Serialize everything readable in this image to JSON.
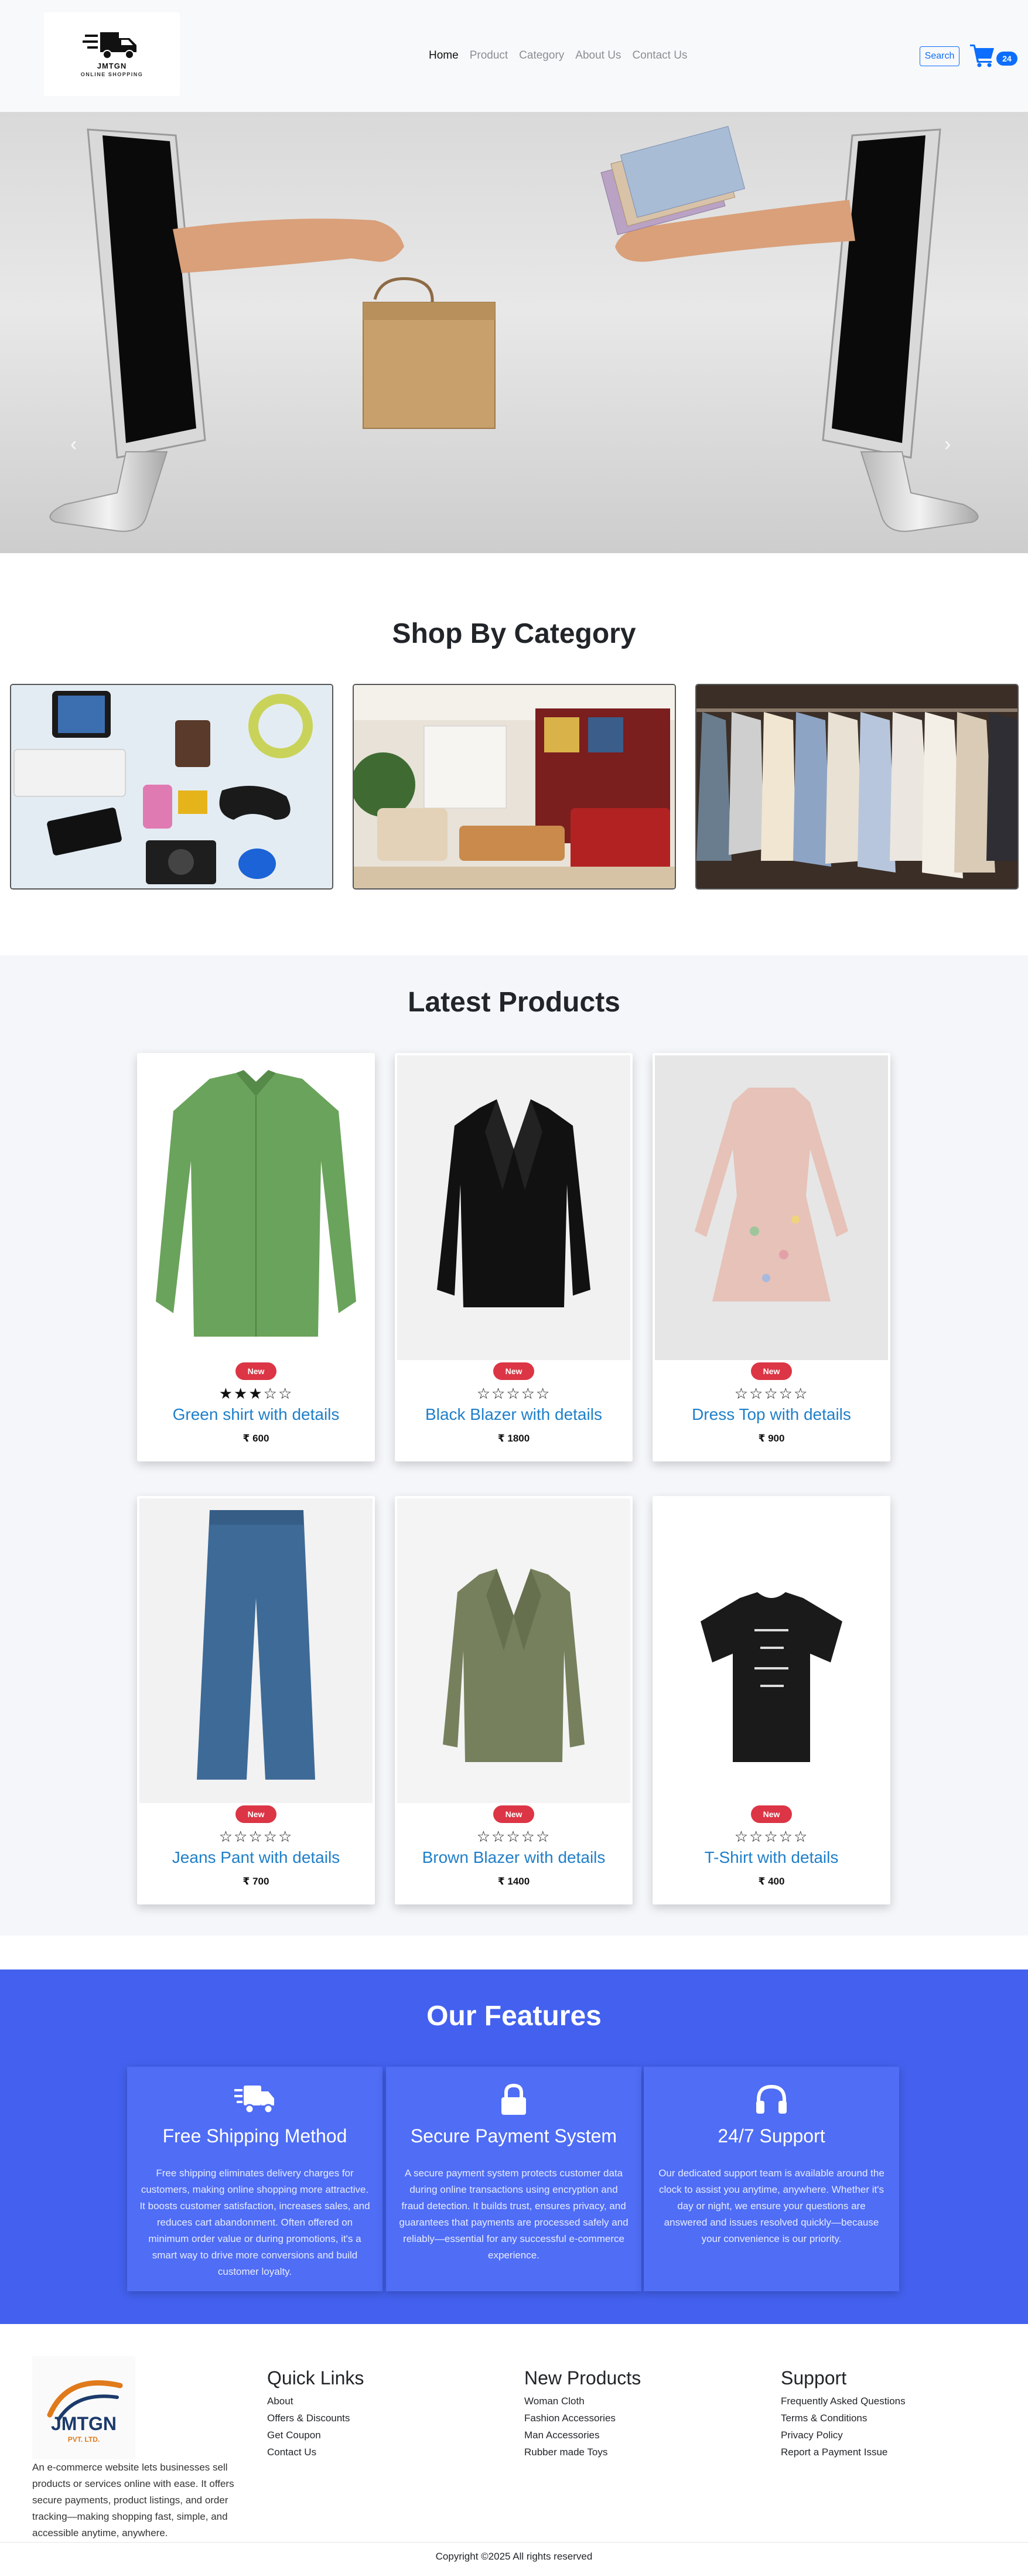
{
  "navbar": {
    "logo_brand": "JMTGN",
    "logo_tagline": "ONLINE SHOPPING",
    "links": [
      {
        "label": "Home"
      },
      {
        "label": "Product"
      },
      {
        "label": "Category"
      },
      {
        "label": "About Us"
      },
      {
        "label": "Contact Us"
      }
    ],
    "search_label": "Search",
    "cart_count": "24",
    "accent_color": "#0d6efd"
  },
  "hero": {
    "prev_icon": "chevron-left-icon",
    "next_icon": "chevron-right-icon",
    "scroll_top_icon": "chevron-up-icon"
  },
  "category": {
    "title": "Shop By Category",
    "cards": [
      {
        "image": "electronics-flatlay"
      },
      {
        "image": "living-room-furniture"
      },
      {
        "image": "clothing-rack"
      }
    ]
  },
  "latest": {
    "title": "Latest Products",
    "products": [
      {
        "name": "Green shirt with details",
        "price": "₹ 600",
        "badge": "New",
        "stars": "★★★☆☆",
        "image": "green-shirt"
      },
      {
        "name": "Black Blazer with details",
        "price": "₹ 1800",
        "badge": "New",
        "stars": "☆☆☆☆☆",
        "image": "black-blazer"
      },
      {
        "name": "Dress Top with details",
        "price": "₹ 900",
        "badge": "New",
        "stars": "☆☆☆☆☆",
        "image": "floral-dress"
      },
      {
        "name": "Jeans Pant with details",
        "price": "₹ 700",
        "badge": "New",
        "stars": "☆☆☆☆☆",
        "image": "jeans-pant"
      },
      {
        "name": "Brown Blazer with details",
        "price": "₹ 1400",
        "badge": "New",
        "stars": "☆☆☆☆☆",
        "image": "olive-blazer"
      },
      {
        "name": "T-Shirt with details",
        "price": "₹ 400",
        "badge": "New",
        "stars": "☆☆☆☆☆",
        "image": "black-tshirt"
      }
    ],
    "badge_color": "#dc3545",
    "name_color": "#1f7fc9"
  },
  "features": {
    "title": "Our Features",
    "bg_color": "#4361ee",
    "cards": [
      {
        "icon": "shipping-truck-icon",
        "heading": "Free Shipping Method",
        "text": "Free shipping eliminates delivery charges for customers, making online shopping more attractive. It boosts customer satisfaction, increases sales, and reduces cart abandonment. Often offered on minimum order value or during promotions, it's a smart way to drive more conversions and build customer loyalty."
      },
      {
        "icon": "lock-icon",
        "heading": "Secure Payment System",
        "text": "A secure payment system protects customer data during online transactions using encryption and fraud detection. It builds trust, ensures privacy, and guarantees that payments are processed safely and reliably—essential for any successful e-commerce experience."
      },
      {
        "icon": "headphones-icon",
        "heading": "24/7 Support",
        "text": "Our dedicated support team is available around the clock to assist you anytime, anywhere. Whether it's day or night, we ensure your questions are answered and issues resolved quickly—because your convenience is our priority."
      }
    ]
  },
  "footer": {
    "logo_text": "JMTGN",
    "logo_sub": "PVT. LTD.",
    "about": "An e-commerce website lets businesses sell products or services online with ease. It offers secure payments, product listings, and order tracking—making shopping fast, simple, and accessible anytime, anywhere.",
    "columns": [
      {
        "heading": "Quick Links",
        "links": [
          "About",
          "Offers & Discounts",
          "Get Coupon",
          "Contact Us"
        ]
      },
      {
        "heading": "New Products",
        "links": [
          "Woman Cloth",
          "Fashion Accessories",
          "Man Accessories",
          "Rubber made Toys"
        ]
      },
      {
        "heading": "Support",
        "links": [
          "Frequently Asked Questions",
          "Terms & Conditions",
          "Privacy Policy",
          "Report a Payment Issue"
        ]
      }
    ],
    "copyright": "Copyright ©2025 All rights reserved"
  }
}
